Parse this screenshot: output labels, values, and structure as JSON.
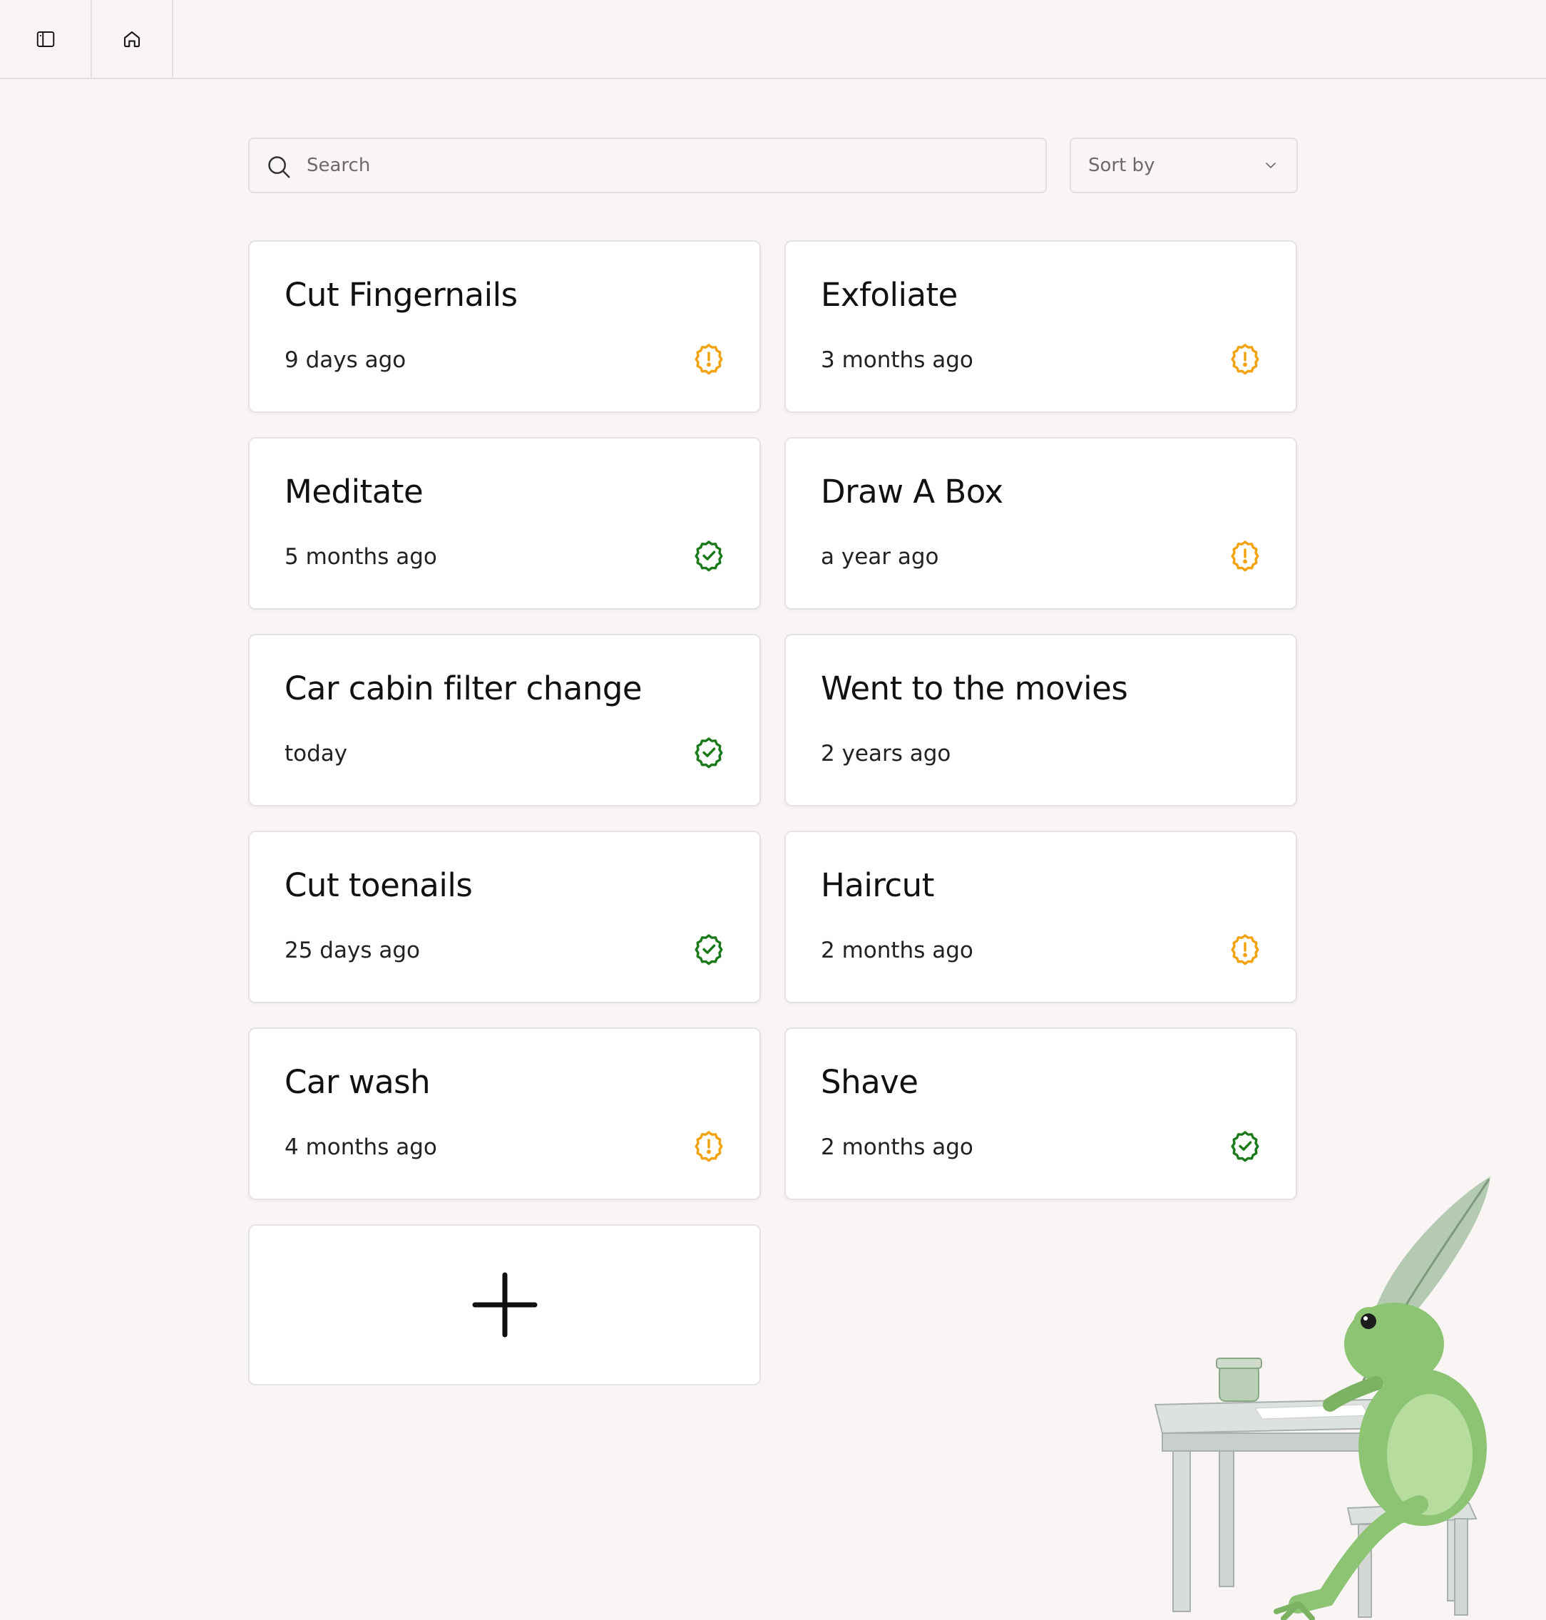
{
  "topbar": {
    "sidebar_toggle": "sidebar-toggle-icon",
    "home": "home-icon"
  },
  "search": {
    "placeholder": "Search",
    "value": ""
  },
  "sort": {
    "label": "Sort by",
    "icon": "chevron-down-icon"
  },
  "colors": {
    "warning": "#f2a20c",
    "ok": "#1a7a1a",
    "background": "#f8f5f4",
    "card": "#ffffff"
  },
  "cards": [
    {
      "title": "Cut Fingernails",
      "subtitle": "9 days ago",
      "status": "warning"
    },
    {
      "title": "Exfoliate",
      "subtitle": "3 months ago",
      "status": "warning"
    },
    {
      "title": "Meditate",
      "subtitle": "5 months ago",
      "status": "ok"
    },
    {
      "title": "Draw A Box",
      "subtitle": "a year ago",
      "status": "warning"
    },
    {
      "title": "Car cabin filter change",
      "subtitle": "today",
      "status": "ok"
    },
    {
      "title": "Went to the movies",
      "subtitle": "2 years ago",
      "status": "none"
    },
    {
      "title": "Cut toenails",
      "subtitle": "25 days ago",
      "status": "ok"
    },
    {
      "title": "Haircut",
      "subtitle": "2 months ago",
      "status": "warning"
    },
    {
      "title": "Car wash",
      "subtitle": "4 months ago",
      "status": "warning"
    },
    {
      "title": "Shave",
      "subtitle": "2 months ago",
      "status": "ok"
    }
  ],
  "add_card": {
    "icon": "plus-icon"
  },
  "illustration": {
    "icon": "frog-writing-illustration"
  }
}
